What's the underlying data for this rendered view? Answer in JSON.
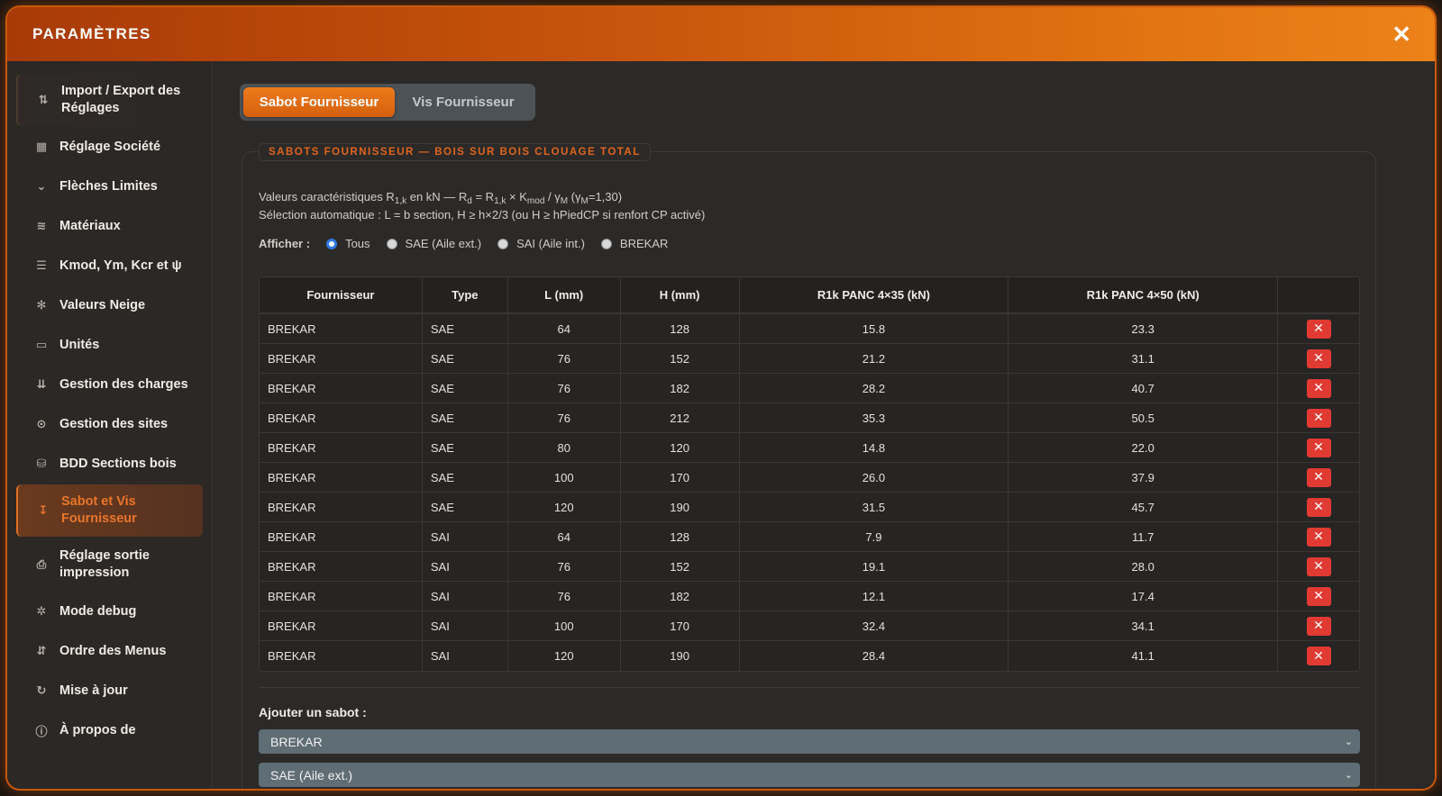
{
  "window": {
    "title": "PARAMÈTRES",
    "close_label": "✕"
  },
  "sidebar": {
    "items": [
      {
        "label": "Import / Export des Réglages",
        "icon": "import-export-icon",
        "glyph": "⇅"
      },
      {
        "label": "Réglage Société",
        "icon": "building-icon",
        "glyph": "▦"
      },
      {
        "label": "Flèches Limites",
        "icon": "deflection-icon",
        "glyph": "⌄"
      },
      {
        "label": "Matériaux",
        "icon": "layers-icon",
        "glyph": "≋"
      },
      {
        "label": "Kmod, Ym, Kcr et ψ",
        "icon": "sliders-icon",
        "glyph": "☰"
      },
      {
        "label": "Valeurs Neige",
        "icon": "snowflake-icon",
        "glyph": "✻"
      },
      {
        "label": "Unités",
        "icon": "ruler-icon",
        "glyph": "▭"
      },
      {
        "label": "Gestion des charges",
        "icon": "loads-icon",
        "glyph": "⇊"
      },
      {
        "label": "Gestion des sites",
        "icon": "map-pin-icon",
        "glyph": "⊙"
      },
      {
        "label": "BDD Sections bois",
        "icon": "database-icon",
        "glyph": "⛁"
      },
      {
        "label": "Sabot et Vis Fournisseur",
        "icon": "screw-icon",
        "glyph": "↧"
      },
      {
        "label": "Réglage sortie impression",
        "icon": "printer-icon",
        "glyph": "⎙"
      },
      {
        "label": "Mode debug",
        "icon": "bug-icon",
        "glyph": "✲"
      },
      {
        "label": "Ordre des Menus",
        "icon": "sort-icon",
        "glyph": "⇵"
      },
      {
        "label": "Mise à jour",
        "icon": "refresh-icon",
        "glyph": "↻"
      },
      {
        "label": "À propos de",
        "icon": "info-icon",
        "glyph": "ⓘ"
      }
    ],
    "active_index": 10
  },
  "tabs": {
    "sabot": "Sabot Fournisseur",
    "vis": "Vis Fournisseur"
  },
  "section": {
    "legend": "SABOTS FOURNISSEUR — BOIS SUR BOIS CLOUAGE TOTAL",
    "info_line1": {
      "a": "Valeurs caractéristiques R",
      "a_sub": "1,k",
      "b": " en kN — R",
      "b_sub": "d",
      "c": " = R",
      "c_sub": "1,k",
      "d": " × K",
      "d_sub": "mod",
      "e": " / γ",
      "e_sub": "M",
      "f": " (γ",
      "f_sub": "M",
      "g": "=1,30)"
    },
    "info_line2": "Sélection automatique : L = b section, H ≥ h×2/3 (ou H ≥ hPiedCP si renfort CP activé)"
  },
  "filter": {
    "label": "Afficher :",
    "options": [
      "Tous",
      "SAE (Aile ext.)",
      "SAI (Aile int.)",
      "BREKAR"
    ],
    "selected_index": 0
  },
  "table": {
    "headers": [
      "Fournisseur",
      "Type",
      "L (mm)",
      "H (mm)",
      "R1k PANC 4×35 (kN)",
      "R1k PANC 4×50 (kN)",
      ""
    ],
    "delete_label": "✕",
    "rows": [
      [
        "BREKAR",
        "SAE",
        "64",
        "128",
        "15.8",
        "23.3"
      ],
      [
        "BREKAR",
        "SAE",
        "76",
        "152",
        "21.2",
        "31.1"
      ],
      [
        "BREKAR",
        "SAE",
        "76",
        "182",
        "28.2",
        "40.7"
      ],
      [
        "BREKAR",
        "SAE",
        "76",
        "212",
        "35.3",
        "50.5"
      ],
      [
        "BREKAR",
        "SAE",
        "80",
        "120",
        "14.8",
        "22.0"
      ],
      [
        "BREKAR",
        "SAE",
        "100",
        "170",
        "26.0",
        "37.9"
      ],
      [
        "BREKAR",
        "SAE",
        "120",
        "190",
        "31.5",
        "45.7"
      ],
      [
        "BREKAR",
        "SAI",
        "64",
        "128",
        "7.9",
        "11.7"
      ],
      [
        "BREKAR",
        "SAI",
        "76",
        "152",
        "19.1",
        "28.0"
      ],
      [
        "BREKAR",
        "SAI",
        "76",
        "182",
        "12.1",
        "17.4"
      ],
      [
        "BREKAR",
        "SAI",
        "100",
        "170",
        "32.4",
        "34.1"
      ],
      [
        "BREKAR",
        "SAI",
        "120",
        "190",
        "28.4",
        "41.1"
      ]
    ]
  },
  "add_form": {
    "label": "Ajouter un sabot :",
    "fournisseur_value": "BREKAR",
    "type_value": "SAE (Aile ext.)"
  },
  "colors": {
    "accent": "#e0641c",
    "delete": "#e03a32",
    "radio": "#2f7ae0"
  }
}
